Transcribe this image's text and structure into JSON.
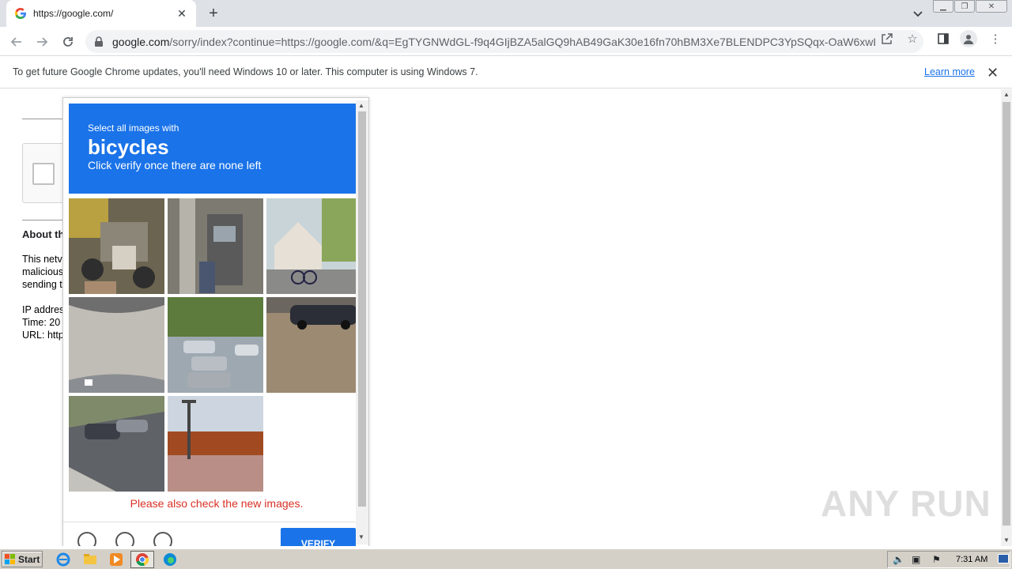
{
  "browser": {
    "tab_title": "https://google.com/",
    "address_host": "google.com",
    "address_rest": "/sorry/index?continue=https://google.com/&q=EgTYGNWdGL-f9q4GIjBZA5alGQ9hAB49GaK30e16fn70hBM3Xe7BLENDPC3YpSQqx-OaW6xwL..."
  },
  "infobar": {
    "message": "To get future Google Chrome updates, you'll need Windows 10 or later. This computer is using Windows 7.",
    "learn_more": "Learn more"
  },
  "page": {
    "about_heading": "About th",
    "lines": [
      "This netv",
      "malicious",
      "sending t",
      "IP addres",
      "Time: 20",
      "URL: http"
    ]
  },
  "captcha": {
    "instruction_small": "Select all images with",
    "target": "bicycles",
    "instruction_sub": "Click verify once there are none left",
    "error": "Please also check the new images.",
    "verify_label": "VERIFY"
  },
  "watermark": "ANY RUN",
  "taskbar": {
    "start_label": "Start",
    "time": "7:31 AM"
  },
  "colors": {
    "captcha_blue": "#1a73e8",
    "error_red": "#d93025"
  }
}
